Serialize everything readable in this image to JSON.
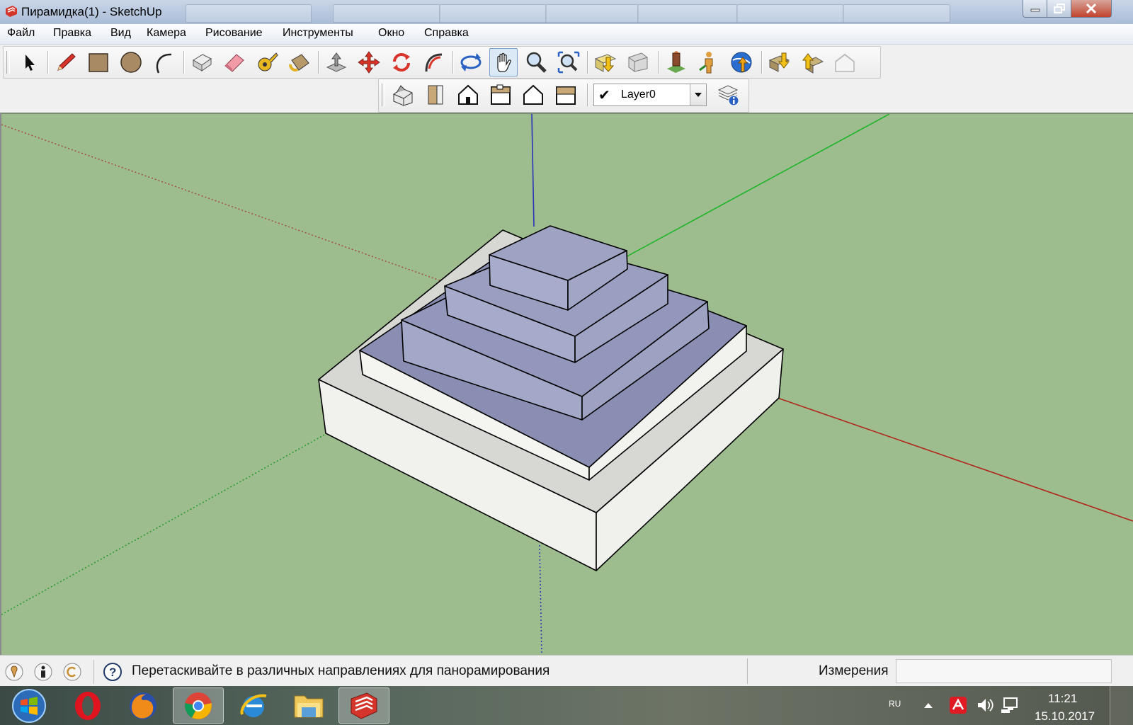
{
  "window": {
    "title": "Пирамидка(1) - SketchUp",
    "buttons": {
      "minimize": "minimize-icon",
      "maximize": "restore-icon",
      "close": "close-icon"
    }
  },
  "menu": [
    "Файл",
    "Правка",
    "Вид",
    "Камера",
    "Рисование",
    "Инструменты",
    "Окно",
    "Справка"
  ],
  "toolbar": {
    "tools": [
      "select-icon",
      "pencil-icon",
      "rectangle-icon",
      "circle-icon",
      "arc-icon",
      "make-component-icon",
      "eraser-icon",
      "tape-measure-icon",
      "paint-bucket-icon",
      "push-pull-icon",
      "move-icon",
      "rotate-icon",
      "follow-me-icon",
      "orbit-icon",
      "pan-icon",
      "zoom-icon",
      "zoom-extents-icon",
      "get-models-icon",
      "share-component-icon",
      "styles-icon",
      "walk-icon",
      "google-earth-icon",
      "import-icon",
      "export-icon",
      "warehouse-icon"
    ],
    "active_tool": "pan-icon",
    "views": [
      "iso-view-icon",
      "top-view-icon",
      "front-view-icon",
      "right-view-icon",
      "back-view-icon",
      "left-view-icon"
    ],
    "layer": {
      "checked": "✔",
      "name": "Layer0"
    },
    "layer_manager": "layer-info-icon"
  },
  "status": {
    "hint": "Перетаскивайте в различных направлениях для панорамирования",
    "measurements_label": "Измерения",
    "measurements_value": ""
  },
  "taskbar": {
    "apps": [
      "start-orb-icon",
      "opera-icon",
      "firefox-icon",
      "chrome-icon",
      "ie-icon",
      "explorer-icon",
      "sketchup-icon"
    ],
    "active_app": "sketchup-icon",
    "lang": "RU",
    "time": "11:21",
    "date": "15.10.2017"
  },
  "colors": {
    "viewport": "#9ebd8f",
    "pyramid_blue": "#a4a8c8",
    "pyramid_white": "#f1f1ee"
  }
}
